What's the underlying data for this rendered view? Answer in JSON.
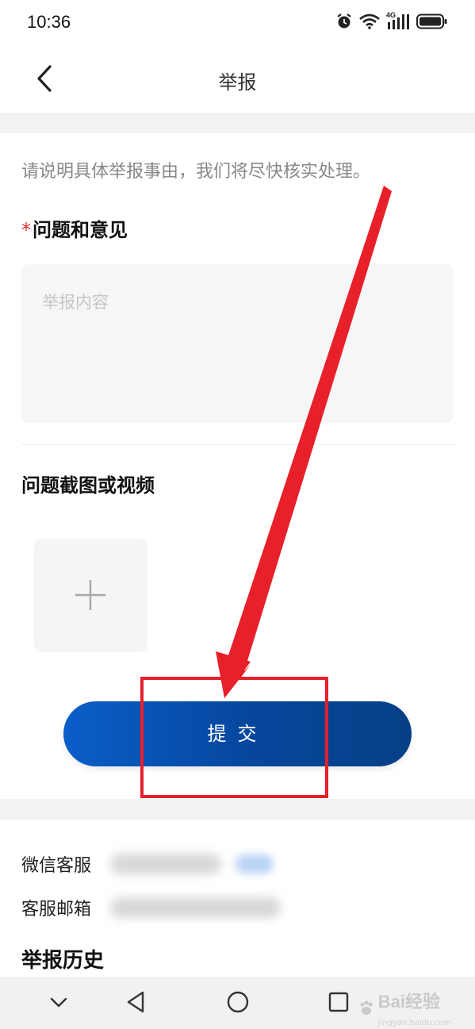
{
  "status_bar": {
    "time": "10:36",
    "network_label": "4G"
  },
  "nav": {
    "title": "举报"
  },
  "form": {
    "hint": "请说明具体举报事由，我们将尽快核实处理。",
    "required_mark": "*",
    "issue_label": "问题和意见",
    "content_placeholder": "举报内容",
    "content_value": "",
    "media_label": "问题截图或视频"
  },
  "submit_label": "提交",
  "contact": {
    "wechat_label": "微信客服",
    "email_label": "客服邮箱"
  },
  "history_title": "举报历史",
  "watermark": {
    "text": "Bai经验",
    "sub": "jingyan.baidu.com"
  },
  "colors": {
    "accent": "#0a5ec9",
    "annotation_red": "#e8202a"
  }
}
